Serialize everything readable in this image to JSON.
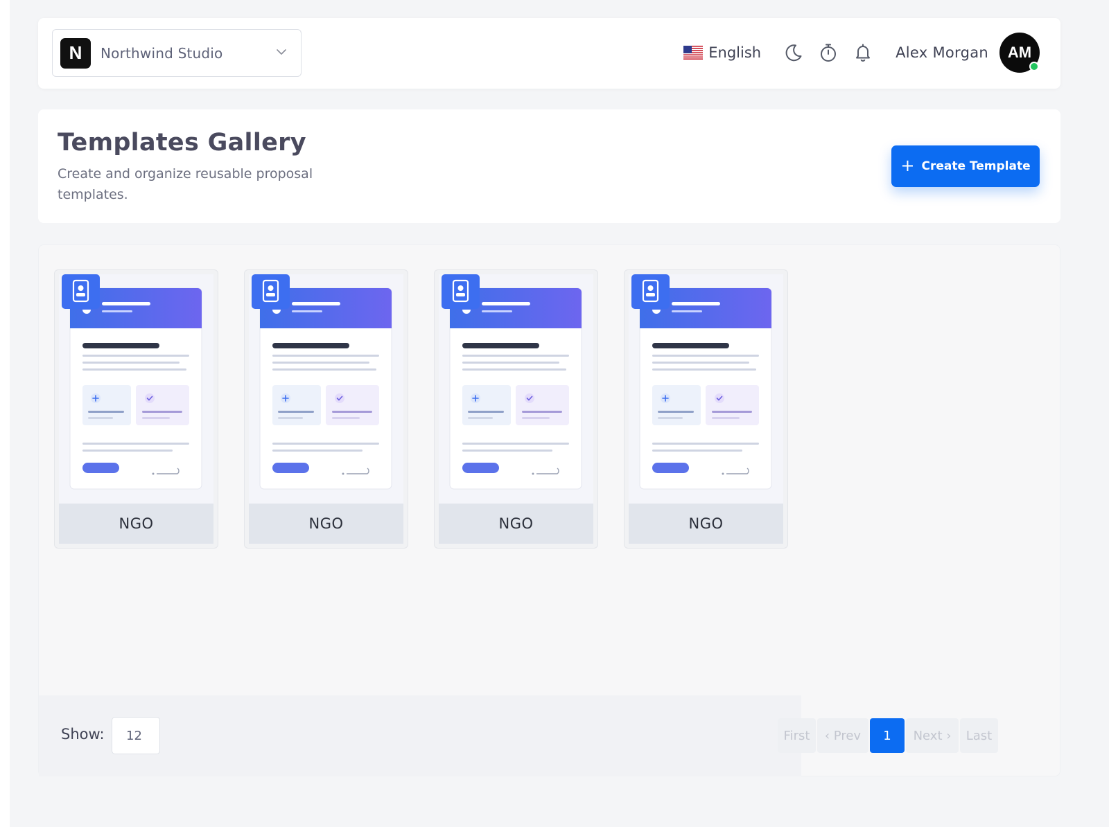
{
  "workspace": {
    "logo_letter": "N",
    "name": "Northwind Studio"
  },
  "topbar": {
    "language": "English",
    "icons": [
      "moon-icon",
      "stopwatch-icon",
      "bell-icon"
    ],
    "user_name": "Alex Morgan",
    "avatar_initials": "AM",
    "online_status_color": "#22c55e"
  },
  "header": {
    "title": "Templates Gallery",
    "subtitle": "Create and organize reusable proposal templates.",
    "create_button": {
      "icon": "+",
      "label": "Create Template"
    }
  },
  "templates": [
    {
      "label": "NGO"
    },
    {
      "label": "NGO"
    },
    {
      "label": "NGO"
    },
    {
      "label": "NGO"
    }
  ],
  "footer": {
    "show_label": "Show:",
    "page_size": "12",
    "pagination": {
      "first": "First",
      "prev": "‹ Prev",
      "current": "1",
      "next": "Next ›",
      "last": "Last"
    }
  },
  "colors": {
    "accent": "#0c6cf2",
    "thumb_header_start": "#3f6fe9",
    "thumb_header_end": "#6d66ef"
  }
}
